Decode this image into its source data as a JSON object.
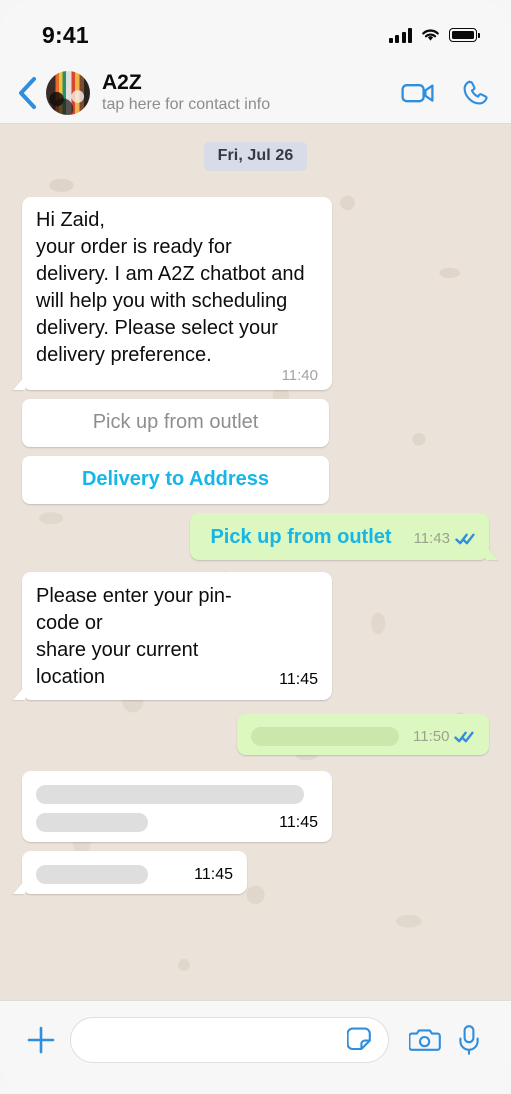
{
  "statusbar": {
    "time": "9:41",
    "signal_icon": "cellular-signal-icon",
    "wifi_icon": "wifi-icon",
    "battery_icon": "battery-full-icon"
  },
  "header": {
    "back_icon": "back-chevron-icon",
    "avatar_icon": "contact-avatar",
    "contact_name": "A2Z",
    "contact_subtitle": "tap here for contact info",
    "video_call_icon": "video-call-icon",
    "voice_call_icon": "voice-call-icon"
  },
  "chat": {
    "date_divider": "Fri, Jul 26",
    "messages": [
      {
        "id": "msg-greeting",
        "direction": "in",
        "text": "Hi Zaid,\nyour order is ready for\ndelivery. I am A2Z chatbot and\nwill help you with scheduling\ndelivery. Please select your\ndelivery preference.",
        "time": "11:40"
      },
      {
        "id": "msg-pincode-request",
        "direction": "in",
        "text": "Please enter your pin-code or\nshare your current location",
        "time": "11:45"
      },
      {
        "id": "msg-reply-pickup",
        "direction": "out",
        "text": "Pick up from outlet",
        "time": "11:43"
      },
      {
        "id": "msg-redacted-out",
        "direction": "out",
        "text": "",
        "time": "11:50"
      },
      {
        "id": "msg-redacted-in-1",
        "direction": "in",
        "text": "",
        "time": "11:45"
      },
      {
        "id": "msg-redacted-in-2",
        "direction": "in",
        "text": "",
        "time": "11:45"
      }
    ],
    "quick_replies": [
      {
        "id": "quick-reply-pickup",
        "label": "Pick up from outlet",
        "style": "muted"
      },
      {
        "id": "quick-reply-delivery",
        "label": "Delivery to Address",
        "style": "accent"
      }
    ],
    "read_receipt_icon": "double-check-read-icon"
  },
  "composer": {
    "attach_icon": "plus-attach-icon",
    "input_value": "",
    "input_placeholder": "",
    "sticker_icon": "sticker-icon",
    "camera_icon": "camera-icon",
    "mic_icon": "microphone-icon"
  },
  "colors": {
    "accent_blue": "#16b6e8",
    "ui_blue": "#2f8ede",
    "outgoing_bubble": "#ddf7c0",
    "incoming_bubble": "#ffffff",
    "chat_background": "#ebe3da",
    "date_pill": "#d8dbe8",
    "read_tick": "#2f8ede",
    "muted_text": "#8e8e8e"
  }
}
